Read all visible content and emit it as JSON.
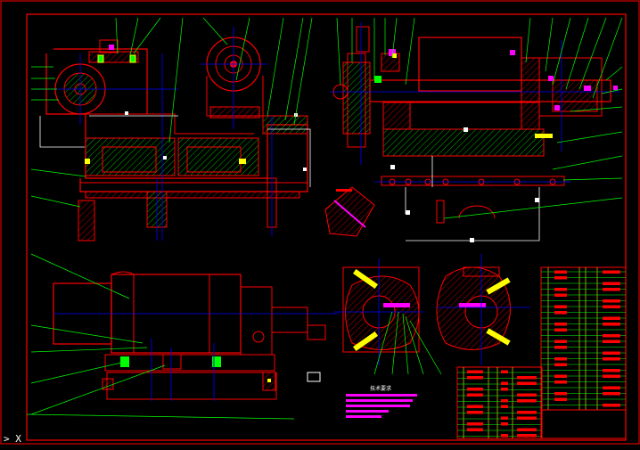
{
  "colors": {
    "background": "#000000",
    "frame": "#ff0000",
    "part": "#ff0000",
    "centerline": "#0000ff",
    "leader": "#00ff00",
    "dimension": "#ffffff",
    "hatch": "#00ff00",
    "highlight": "#ff00ff",
    "yellow": "#ffff00"
  },
  "ucs_icon": {
    "glyph": ">",
    "axis": "X"
  },
  "notes": {
    "title": "技术要求"
  },
  "title_block": {
    "parts_list": "parts-list-table",
    "block": "title-block-table"
  }
}
